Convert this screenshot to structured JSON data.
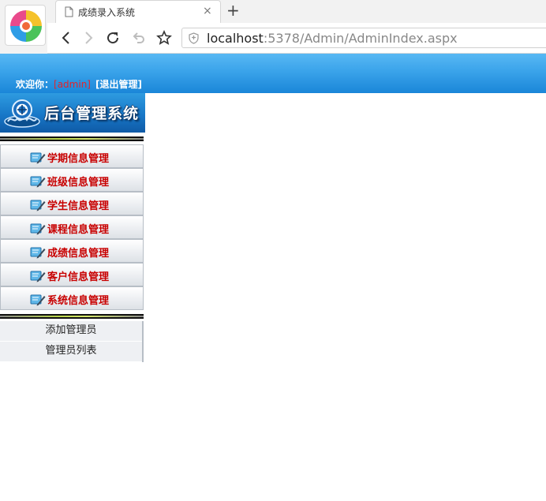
{
  "browser": {
    "tab_title": "成绩录入系统",
    "tab_close": "×",
    "new_tab": "+",
    "url_host": "localhost",
    "url_rest": ":5378/Admin/AdminIndex.aspx"
  },
  "header": {
    "welcome_label": "欢迎你：",
    "user": "[admin]",
    "logout": "[退出管理]"
  },
  "sidebar": {
    "system_title": "后台管理系统",
    "menu": [
      {
        "label": "学期信息管理"
      },
      {
        "label": "班级信息管理"
      },
      {
        "label": "学生信息管理"
      },
      {
        "label": "课程信息管理"
      },
      {
        "label": "成绩信息管理"
      },
      {
        "label": "客户信息管理"
      },
      {
        "label": "系统信息管理"
      }
    ],
    "submenu": [
      {
        "label": "添加管理员"
      },
      {
        "label": "管理员列表"
      }
    ]
  },
  "colors": {
    "topbar": "#3aa3ea",
    "menu_text": "#c80000",
    "user_text": "#e3242b"
  }
}
